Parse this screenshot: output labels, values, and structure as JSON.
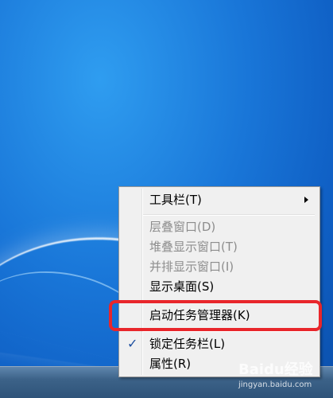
{
  "menu": {
    "items": [
      {
        "label": "工具栏(T)",
        "enabled": true,
        "submenu": true
      },
      {
        "label": "层叠窗口(D)",
        "enabled": false
      },
      {
        "label": "堆叠显示窗口(T)",
        "enabled": false
      },
      {
        "label": "并排显示窗口(I)",
        "enabled": false
      },
      {
        "label": "显示桌面(S)",
        "enabled": true
      },
      {
        "label": "启动任务管理器(K)",
        "enabled": true,
        "highlighted": true
      },
      {
        "label": "锁定任务栏(L)",
        "enabled": true,
        "checked": true,
        "check_mark": "✓"
      },
      {
        "label": "属性(R)",
        "enabled": true
      }
    ]
  },
  "watermark": {
    "brand": "Baidu经验",
    "url": "jingyan.baidu.com"
  },
  "colors": {
    "highlight_border": "#e8262b",
    "desktop": "#1976d8"
  }
}
